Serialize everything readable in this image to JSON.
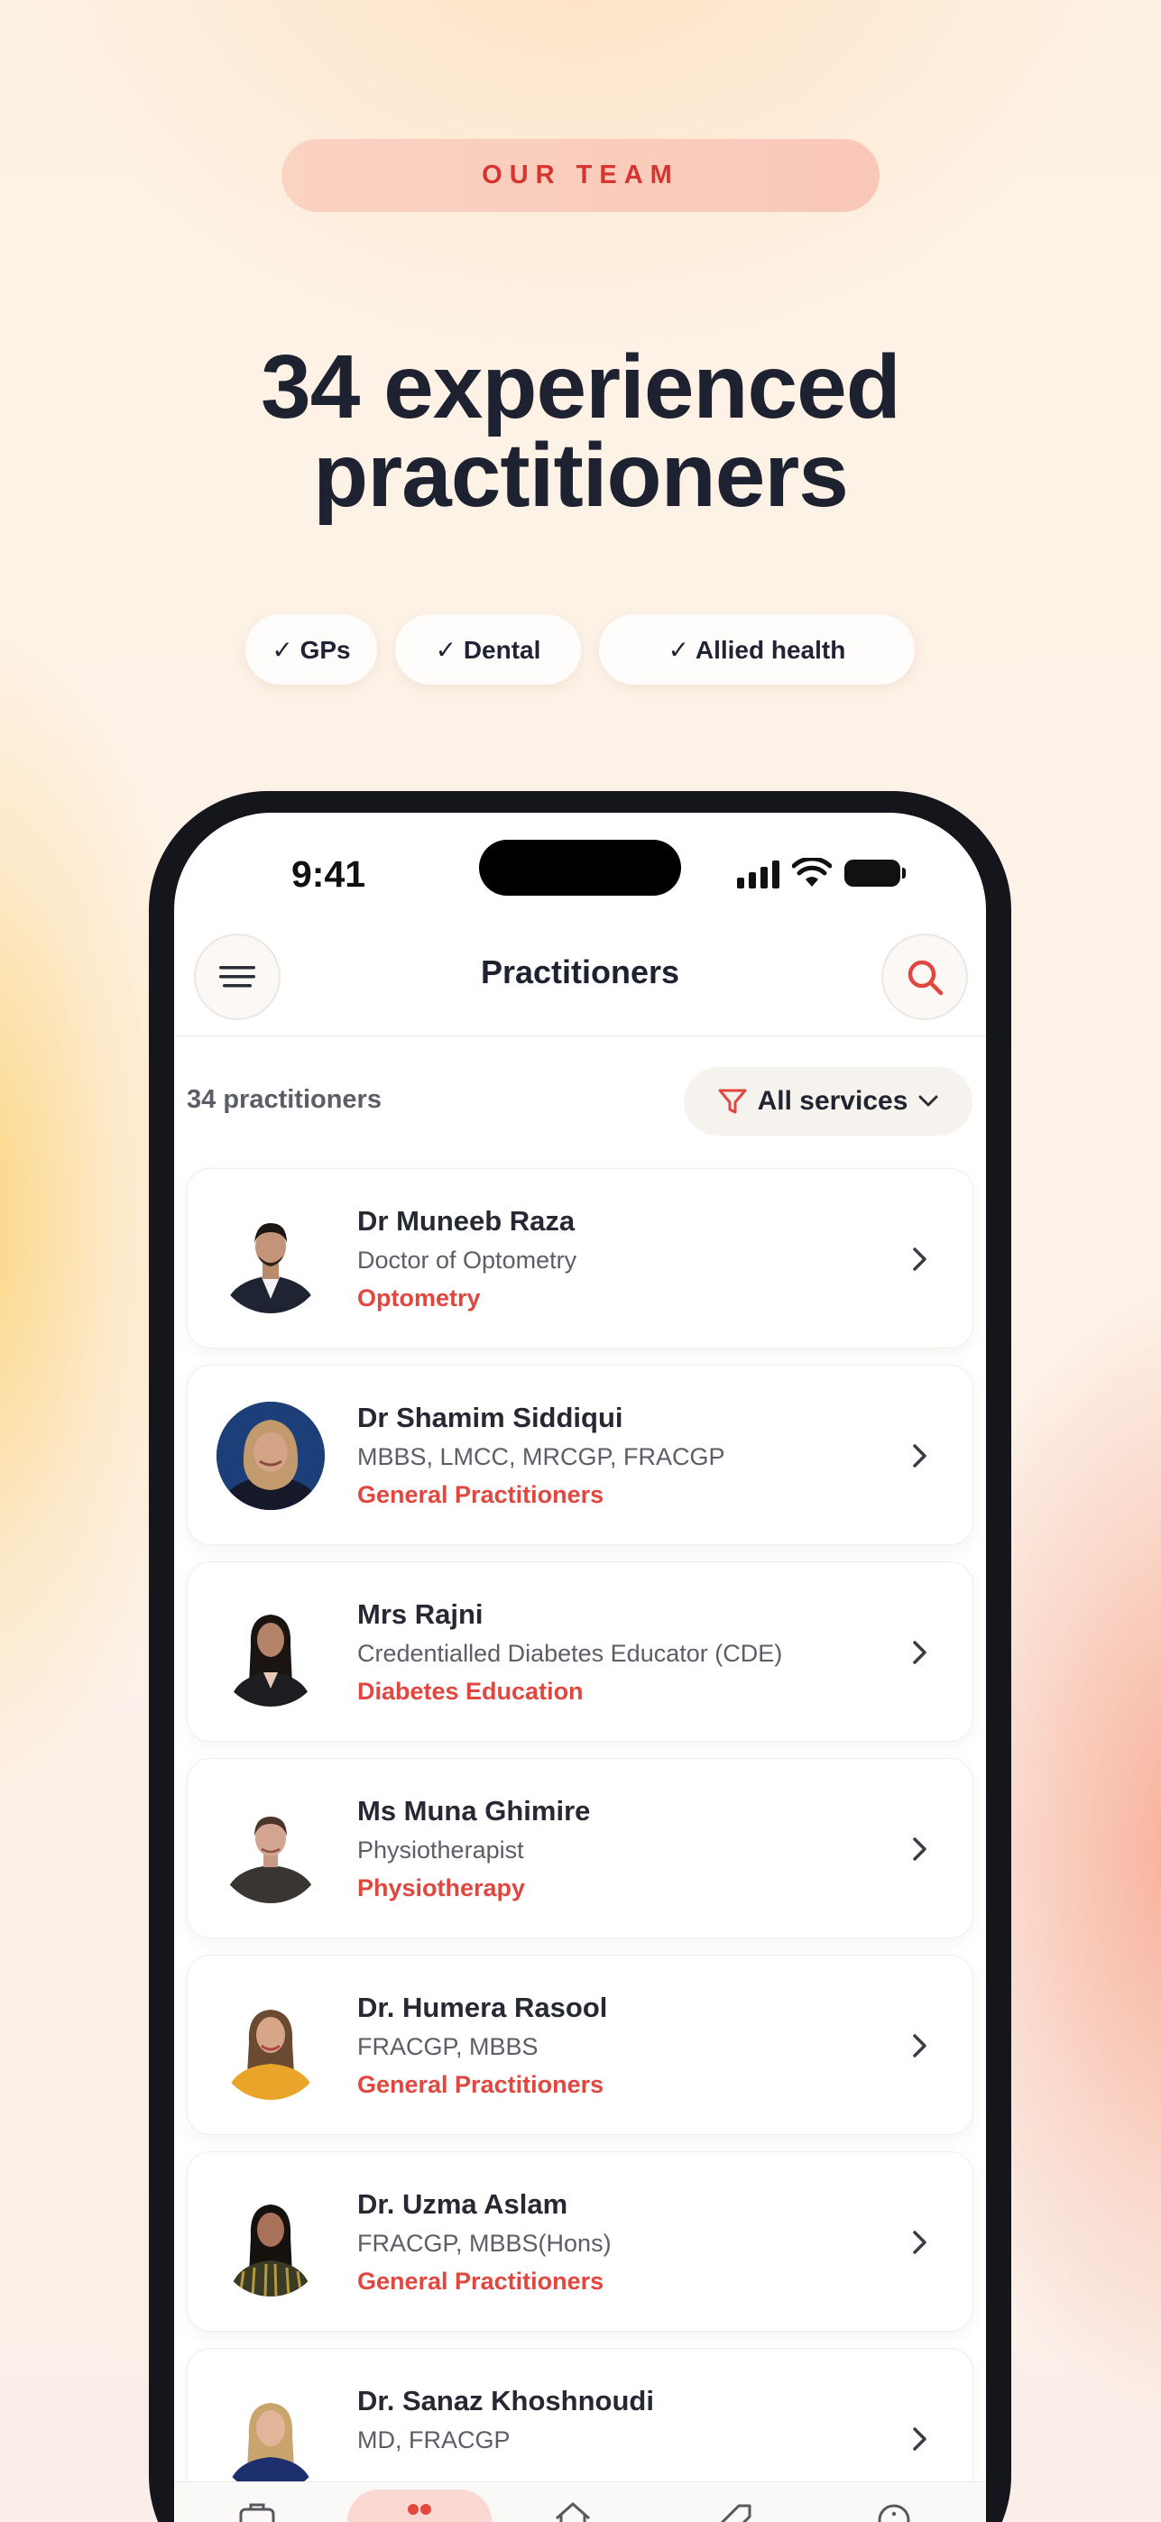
{
  "hero": {
    "eyebrow": "OUR TEAM",
    "headline_line1": "34 experienced",
    "headline_line2": "practitioners",
    "chips": [
      "✓ GPs",
      "✓ Dental",
      "✓ Allied health"
    ]
  },
  "status_bar": {
    "time": "9:41"
  },
  "app": {
    "title": "Practitioners",
    "count_text": "34 practitioners",
    "filter_label": "All services"
  },
  "practitioners": [
    {
      "name": "Dr Muneeb Raza",
      "credentials": "Doctor of Optometry",
      "specialty": "Optometry"
    },
    {
      "name": "Dr Shamim Siddiqui",
      "credentials": "MBBS, LMCC, MRCGP, FRACGP",
      "specialty": "General Practitioners"
    },
    {
      "name": "Mrs Rajni",
      "credentials": "Credentialled Diabetes Educator (CDE)",
      "specialty": "Diabetes Education"
    },
    {
      "name": "Ms Muna Ghimire",
      "credentials": "Physiotherapist",
      "specialty": "Physiotherapy"
    },
    {
      "name": "Dr. Humera Rasool",
      "credentials": "FRACGP, MBBS",
      "specialty": "General Practitioners"
    },
    {
      "name": "Dr. Uzma Aslam",
      "credentials": "FRACGP, MBBS(Hons)",
      "specialty": "General Practitioners"
    },
    {
      "name": "Dr. Sanaz Khoshnoudi",
      "credentials": "MD, FRACGP",
      "specialty": ""
    }
  ],
  "icons": {
    "menu": "hamburger-menu-icon",
    "search": "search-icon",
    "filter": "filter-icon",
    "chevron": "chevron-right-icon"
  },
  "colors": {
    "accent": "#e2473f",
    "eyebrow_bg": "#fbd3c3",
    "heading": "#1e2130",
    "phone_frame": "#15161c"
  }
}
